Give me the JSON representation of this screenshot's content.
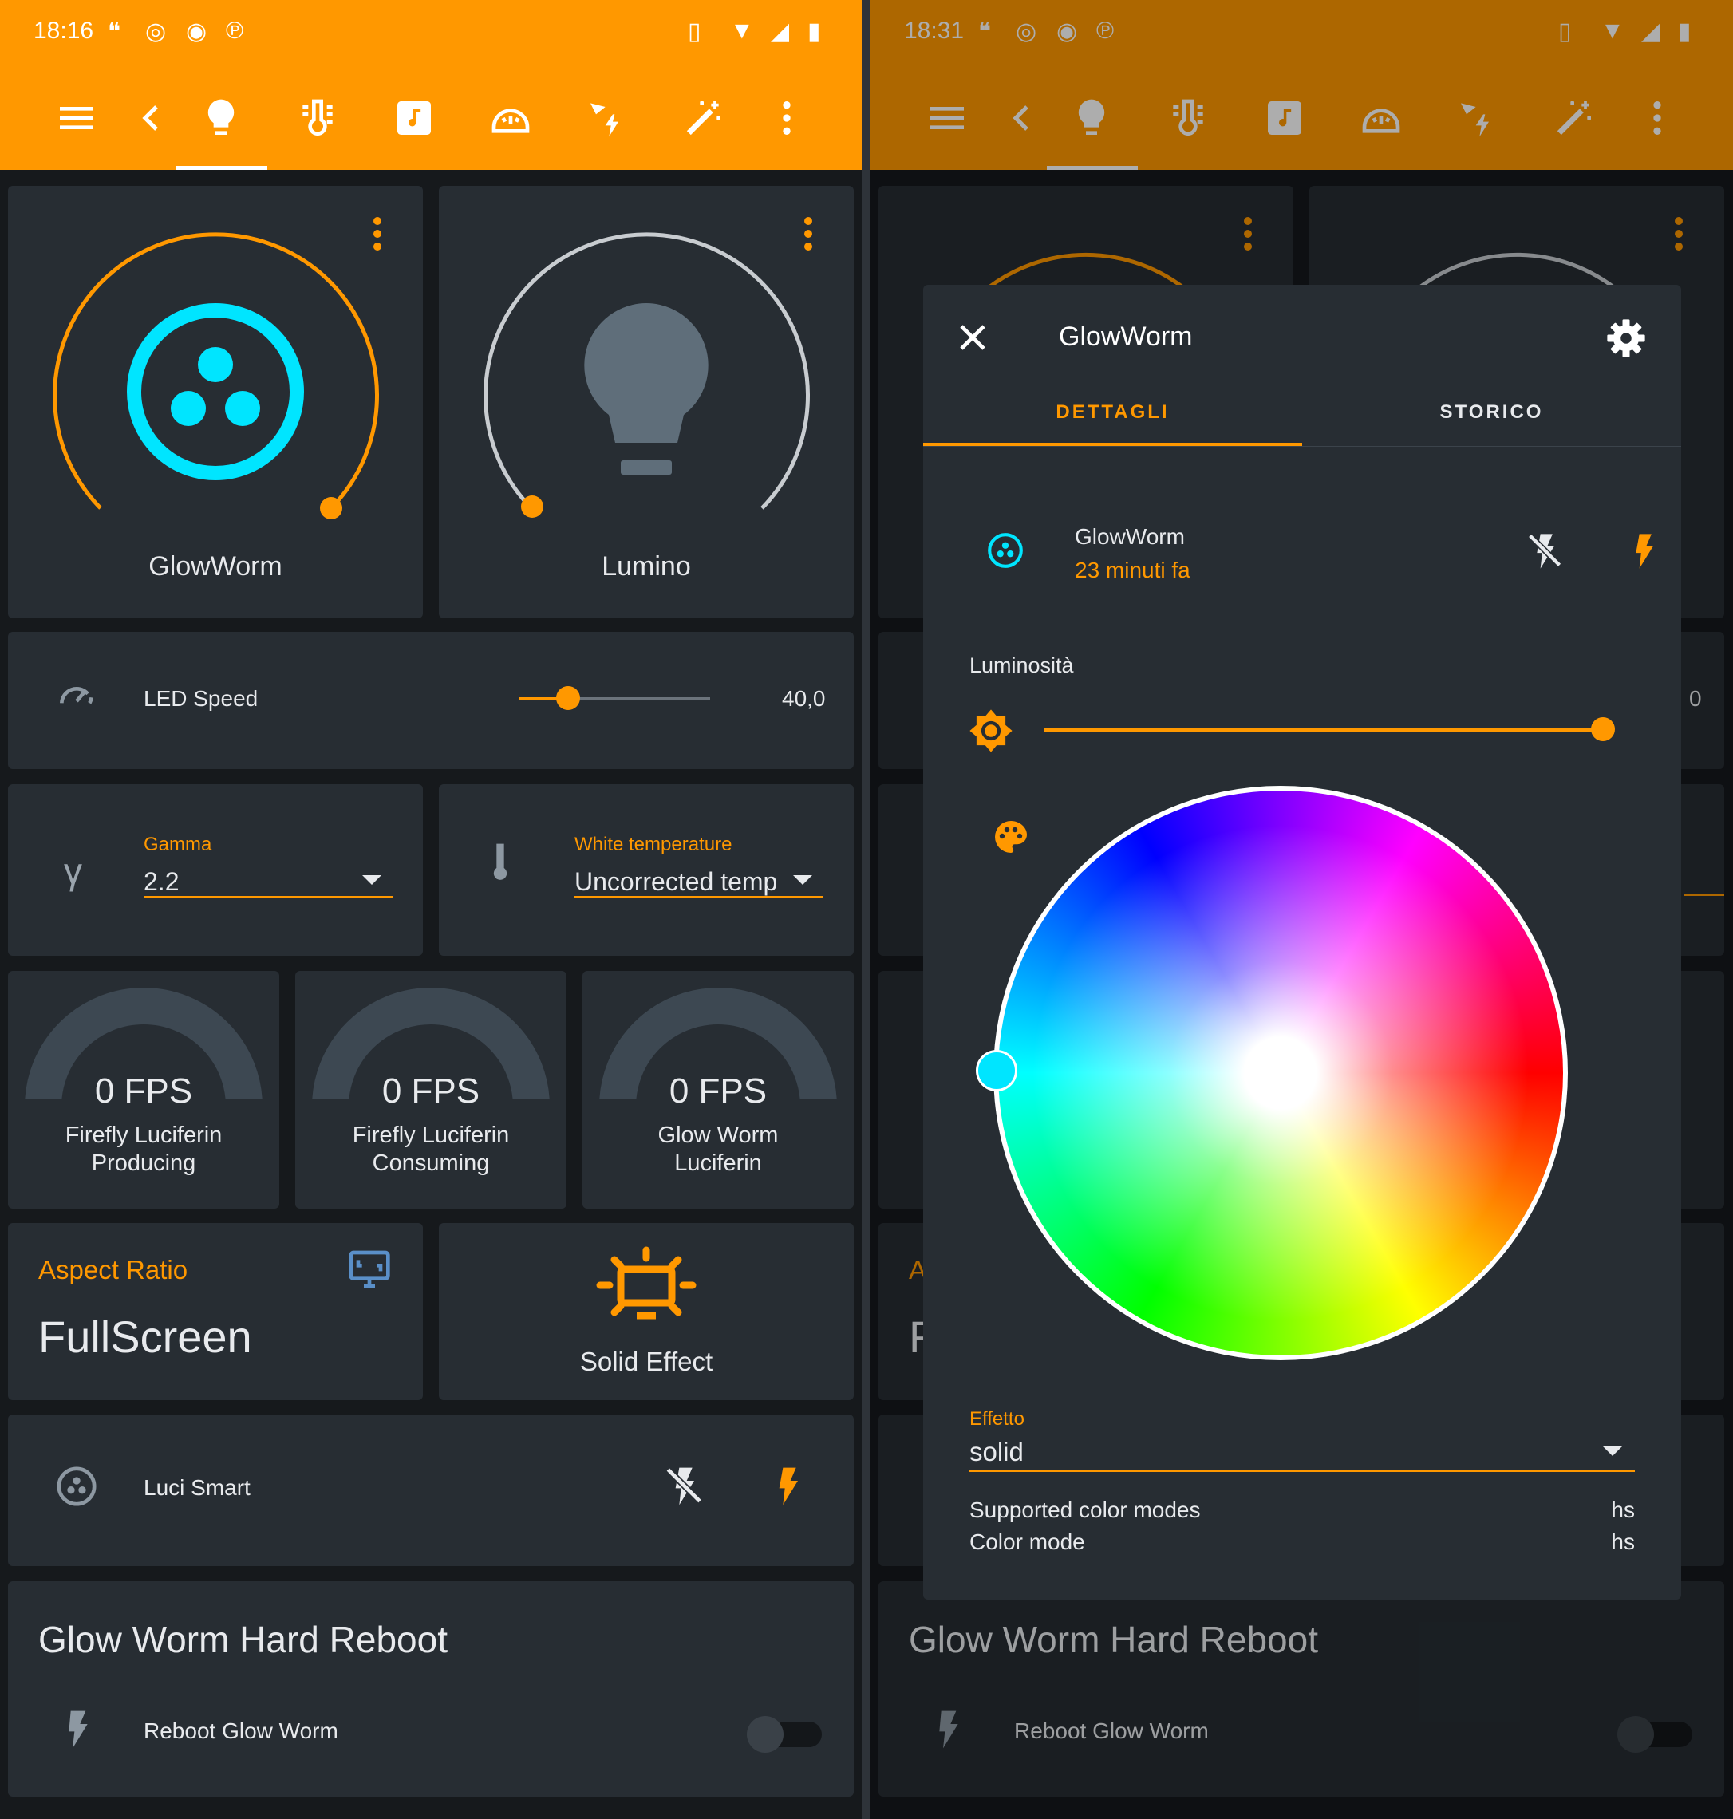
{
  "left": {
    "status": {
      "time": "18:16"
    },
    "cards": {
      "glowworm": {
        "name": "GlowWorm"
      },
      "lumino": {
        "name": "Lumino"
      },
      "led_speed": {
        "label": "LED Speed",
        "value": "40,0"
      },
      "gamma": {
        "label": "Gamma",
        "value": "2.2"
      },
      "white_temp": {
        "label": "White temperature",
        "value": "Uncorrected temp"
      },
      "fps1": {
        "value": "0 FPS",
        "line1": "Firefly Luciferin",
        "line2": "Producing"
      },
      "fps2": {
        "value": "0 FPS",
        "line1": "Firefly Luciferin",
        "line2": "Consuming"
      },
      "fps3": {
        "value": "0 FPS",
        "line1": "Glow Worm",
        "line2": "Luciferin"
      },
      "aspect": {
        "label": "Aspect Ratio",
        "value": "FullScreen"
      },
      "effect": {
        "label": "Solid Effect"
      },
      "smart": {
        "label": "Luci Smart"
      },
      "reboot": {
        "title": "Glow Worm Hard Reboot",
        "item": "Reboot Glow Worm"
      }
    }
  },
  "right": {
    "status": {
      "time": "18:31"
    },
    "bg": {
      "led_value_fragment": "0",
      "aspect_fragment": "A",
      "fullscreen_fragment": "F",
      "reboot_title": "Glow Worm Hard Reboot",
      "reboot_item": "Reboot Glow Worm"
    },
    "dialog": {
      "title": "GlowWorm",
      "tabs": [
        "DETTAGLI",
        "STORICO"
      ],
      "entity": {
        "name": "GlowWorm",
        "time": "23 minuti fa"
      },
      "brightness": {
        "label": "Luminosità",
        "level": 1.0
      },
      "effect": {
        "label": "Effetto",
        "value": "solid"
      },
      "attributes": [
        {
          "key": "Supported color modes",
          "value": "hs"
        },
        {
          "key": "Color mode",
          "value": "hs"
        }
      ]
    }
  },
  "colors": {
    "accent": "#ff9800",
    "cyan": "#00e5ff",
    "card": "#272d33",
    "background": "#16191c"
  }
}
